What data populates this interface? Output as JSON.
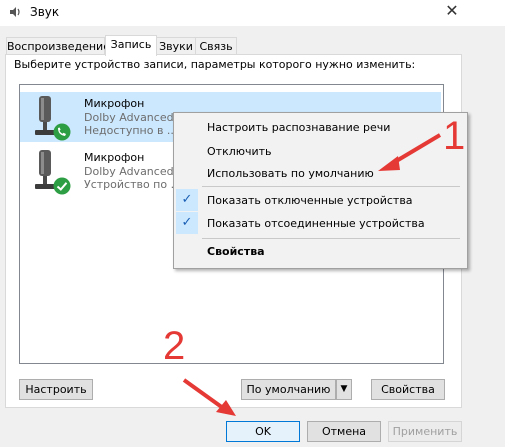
{
  "window": {
    "title": "Звук",
    "close_glyph": "✕"
  },
  "tabs": [
    {
      "label": "Воспроизведение",
      "active": false
    },
    {
      "label": "Запись",
      "active": true
    },
    {
      "label": "Звуки",
      "active": false
    },
    {
      "label": "Связь",
      "active": false
    }
  ],
  "instruction": "Выберите устройство записи, параметры которого нужно изменить:",
  "devices": [
    {
      "name": "Микрофон",
      "line1": "Dolby Advanced ...",
      "line2": "Недоступно в ...",
      "status": "phone-status",
      "selected": true
    },
    {
      "name": "Микрофон",
      "line1": "Dolby Advanced ...",
      "line2": "Устройство по ...",
      "status": "default-check",
      "selected": false
    }
  ],
  "context_menu": {
    "items": [
      {
        "label": "Настроить распознавание речи"
      },
      {
        "label": "Отключить"
      },
      {
        "label": "Использовать по умолчанию"
      },
      {
        "label": "Показать отключенные устройства",
        "checked": true
      },
      {
        "label": "Показать отсоединенные устройства",
        "checked": true
      },
      {
        "label": "Свойства",
        "bold": true
      }
    ]
  },
  "panel_buttons": {
    "configure": "Настроить",
    "set_default": "По умолчанию",
    "properties": "Свойства"
  },
  "dialog_buttons": {
    "ok": "OK",
    "cancel": "Отмена",
    "apply": "Применить"
  },
  "annotations": {
    "step1": "1",
    "step2": "2",
    "color": "#e53935"
  },
  "colors": {
    "selection": "#cce8ff",
    "status_green": "#2e9e44",
    "accent": "#0078d7"
  }
}
